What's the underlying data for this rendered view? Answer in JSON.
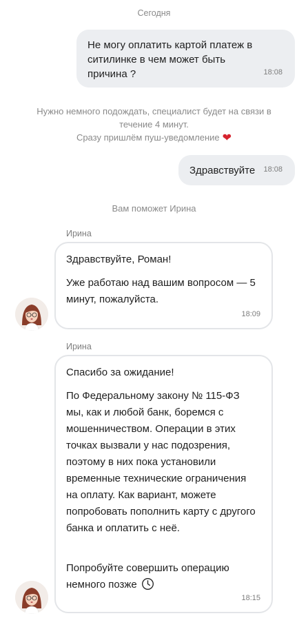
{
  "chat": {
    "date_separator": "Сегодня",
    "messages": {
      "user1": {
        "text": "Не могу оплатить картой платеж в ситилинке в чем может быть причина ?",
        "time": "18:08"
      },
      "system1": {
        "line1": "Нужно немного подождать, специалист будет на связи в",
        "line2": "течение 4 минут.",
        "line3": "Сразу пришлём пуш-уведомление"
      },
      "user2": {
        "text": "Здравствуйте",
        "time": "18:08"
      },
      "system2": {
        "text": "Вам поможет Ирина"
      },
      "agent1": {
        "sender": "Ирина",
        "p1": "Здравствуйте, Роман!",
        "p2": "Уже работаю над вашим вопросом — 5 минут, пожалуйста.",
        "time": "18:09"
      },
      "agent2": {
        "sender": "Ирина",
        "p1": "Спасибо за ожидание!",
        "p2": "По Федеральному закону № 115-ФЗ мы, как и любой банк, боремся с мошенничеством. Операции в этих точках вызвали у нас подозрения, поэтому в них пока установили временные технические ограничения на оплату. Как вариант, можете попробовать пополнить карту с другого банка и оплатить с неё.",
        "p3": "Попробуйте совершить операцию немного позже",
        "time": "18:15"
      }
    },
    "icons": {
      "heart": "heart-icon",
      "clock": "clock-icon",
      "avatar": "agent-avatar"
    },
    "colors": {
      "user_bubble": "#eceef1",
      "agent_border": "#e3e5e8",
      "muted_text": "#8a8a8a",
      "heart": "#d6232e"
    }
  }
}
